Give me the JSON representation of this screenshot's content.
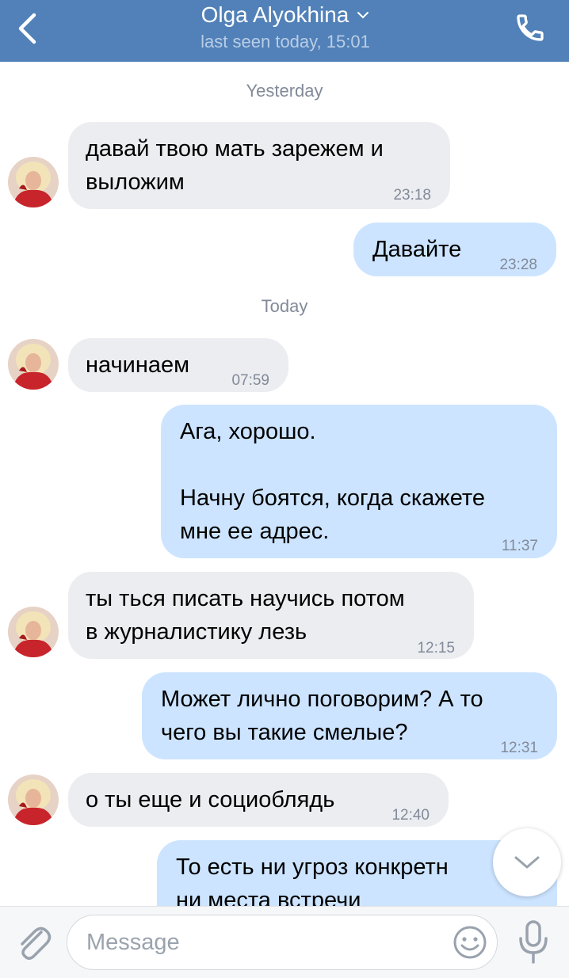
{
  "header": {
    "contact_name": "Olga Alyokhina",
    "last_seen": "last seen today, 15:01",
    "accent_color": "#5181b8"
  },
  "icons": {
    "back": "chevron-left-icon",
    "dropdown": "chevron-down-icon",
    "call": "phone-icon",
    "scroll_down": "chevron-down-icon",
    "attach": "paperclip-icon",
    "emoji": "smile-icon",
    "mic": "microphone-icon"
  },
  "chat": {
    "date_yesterday": "Yesterday",
    "date_today": "Today",
    "messages": [
      {
        "dir": "in",
        "text": "давай твою мать зарежем и\nвыложим",
        "time": "23:18"
      },
      {
        "dir": "out",
        "text": "Давайте",
        "time": "23:28"
      },
      {
        "dir": "in",
        "text": "начинаем",
        "time": "07:59"
      },
      {
        "dir": "out",
        "text": "Ага, хорошо.\n\nНачну боятся, когда скажете\nмне ее адрес.",
        "time": "11:37"
      },
      {
        "dir": "in",
        "text": "ты ться писать научись потом\nв журналистику лезь",
        "time": "12:15"
      },
      {
        "dir": "out",
        "text": "Может лично поговорим? А то\nчего вы такие смелые?",
        "time": "12:31"
      },
      {
        "dir": "in",
        "text": "о ты еще и социоблядь",
        "time": "12:40"
      },
      {
        "dir": "out",
        "text": "То есть ни угроз конкретн\nни места встречи",
        "time": ""
      }
    ]
  },
  "composer": {
    "placeholder": "Message"
  }
}
